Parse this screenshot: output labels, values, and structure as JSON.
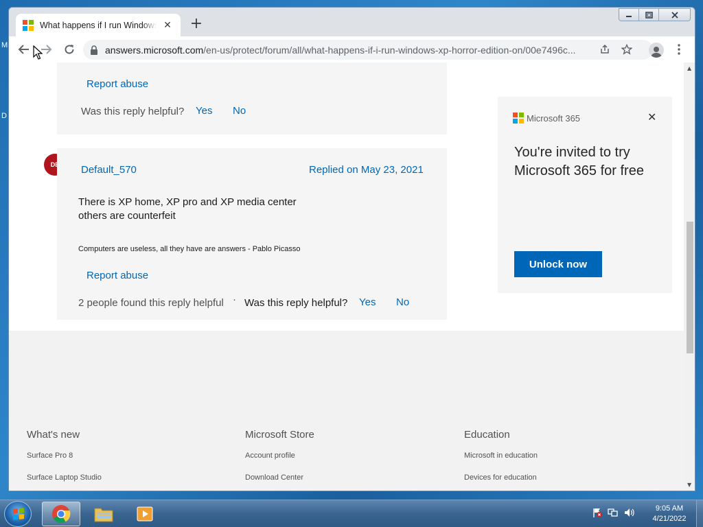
{
  "desktop": {
    "left_letters": [
      "M",
      "D"
    ]
  },
  "browser": {
    "tab": {
      "title": "What happens if I run Windows XP Horror Edition on"
    },
    "url": {
      "host": "answers.microsoft.com",
      "path": "/en-us/protect/forum/all/what-happens-if-i-run-windows-xp-horror-edition-on/00e7496c..."
    }
  },
  "reply_top": {
    "report_label": "Report abuse",
    "helpful_question": "Was this reply helpful?",
    "yes_label": "Yes",
    "no_label": "No"
  },
  "reply_default570": {
    "avatar_initials": "DE",
    "author": "Default_570",
    "date": "Replied on May 23, 2021",
    "body_line1": "There is XP home, XP pro and XP media center",
    "body_line2": "others are counterfeit",
    "signature": "Computers are useless, all they have are answers - Pablo Picasso",
    "report_label": "Report abuse",
    "helpful_count": "2 people found this reply helpful",
    "separator": "·",
    "helpful_question": "Was this reply helpful?",
    "yes_label": "Yes",
    "no_label": "No"
  },
  "ad": {
    "brand": "Microsoft 365",
    "headline": "You're invited to try Microsoft 365 for free",
    "button": "Unlock now"
  },
  "footer": {
    "columns": [
      {
        "title": "What's new",
        "items": [
          "Surface Pro 8",
          "Surface Laptop Studio"
        ]
      },
      {
        "title": "Microsoft Store",
        "items": [
          "Account profile",
          "Download Center"
        ]
      },
      {
        "title": "Education",
        "items": [
          "Microsoft in education",
          "Devices for education"
        ]
      }
    ]
  },
  "taskbar": {
    "time": "9:05 AM",
    "date": "4/21/2022"
  },
  "colors": {
    "ms_red": "#f25022",
    "ms_green": "#7fba00",
    "ms_blue": "#00a4ef",
    "ms_yellow": "#ffb900",
    "link": "#0067b8"
  }
}
